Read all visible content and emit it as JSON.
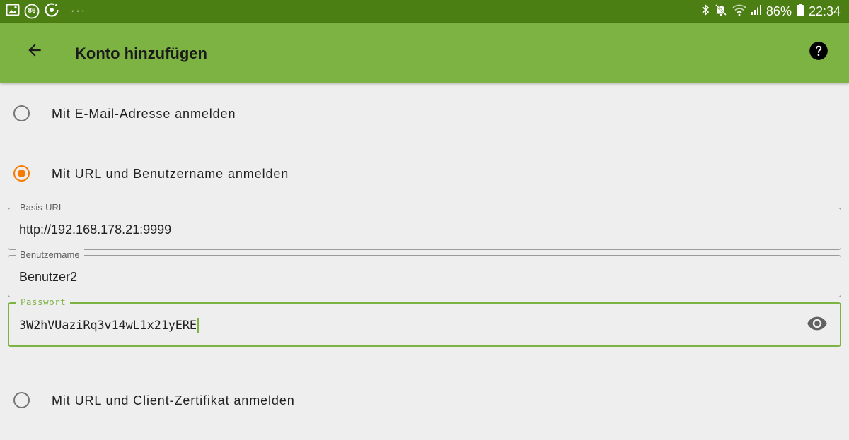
{
  "status_bar": {
    "notification_badge": "86",
    "overflow": "···",
    "battery_percent": "86%",
    "time": "22:34",
    "left_icons": [
      "image-icon",
      "badge-86-icon",
      "sync-icon"
    ],
    "right_icons": [
      "bluetooth-icon",
      "mute-icon",
      "wifi-icon",
      "signal-icon",
      "battery-icon"
    ]
  },
  "app_bar": {
    "title": "Konto hinzufügen",
    "back_icon": "arrow-back-icon",
    "help_icon": "help-circle-icon"
  },
  "login_options": [
    {
      "label": "Mit E-Mail-Adresse anmelden",
      "checked": false
    },
    {
      "label": "Mit URL und Benutzername anmelden",
      "checked": true
    },
    {
      "label": "Mit URL und Client-Zertifikat anmelden",
      "checked": false
    }
  ],
  "fields": {
    "base_url": {
      "label": "Basis-URL",
      "value": "http://192.168.178.21:9999"
    },
    "username": {
      "label": "Benutzername",
      "value": "Benutzer2"
    },
    "password": {
      "label": "Passwort",
      "value": "3W2hVUaziRq3v14wL1x21yERE",
      "toggle_icon": "eye-icon"
    }
  },
  "colors": {
    "status_bar": "#4c7f13",
    "app_bar": "#7cb342",
    "accent_radio": "#f57c00",
    "focus": "#7cb342",
    "background": "#eeeeee"
  }
}
